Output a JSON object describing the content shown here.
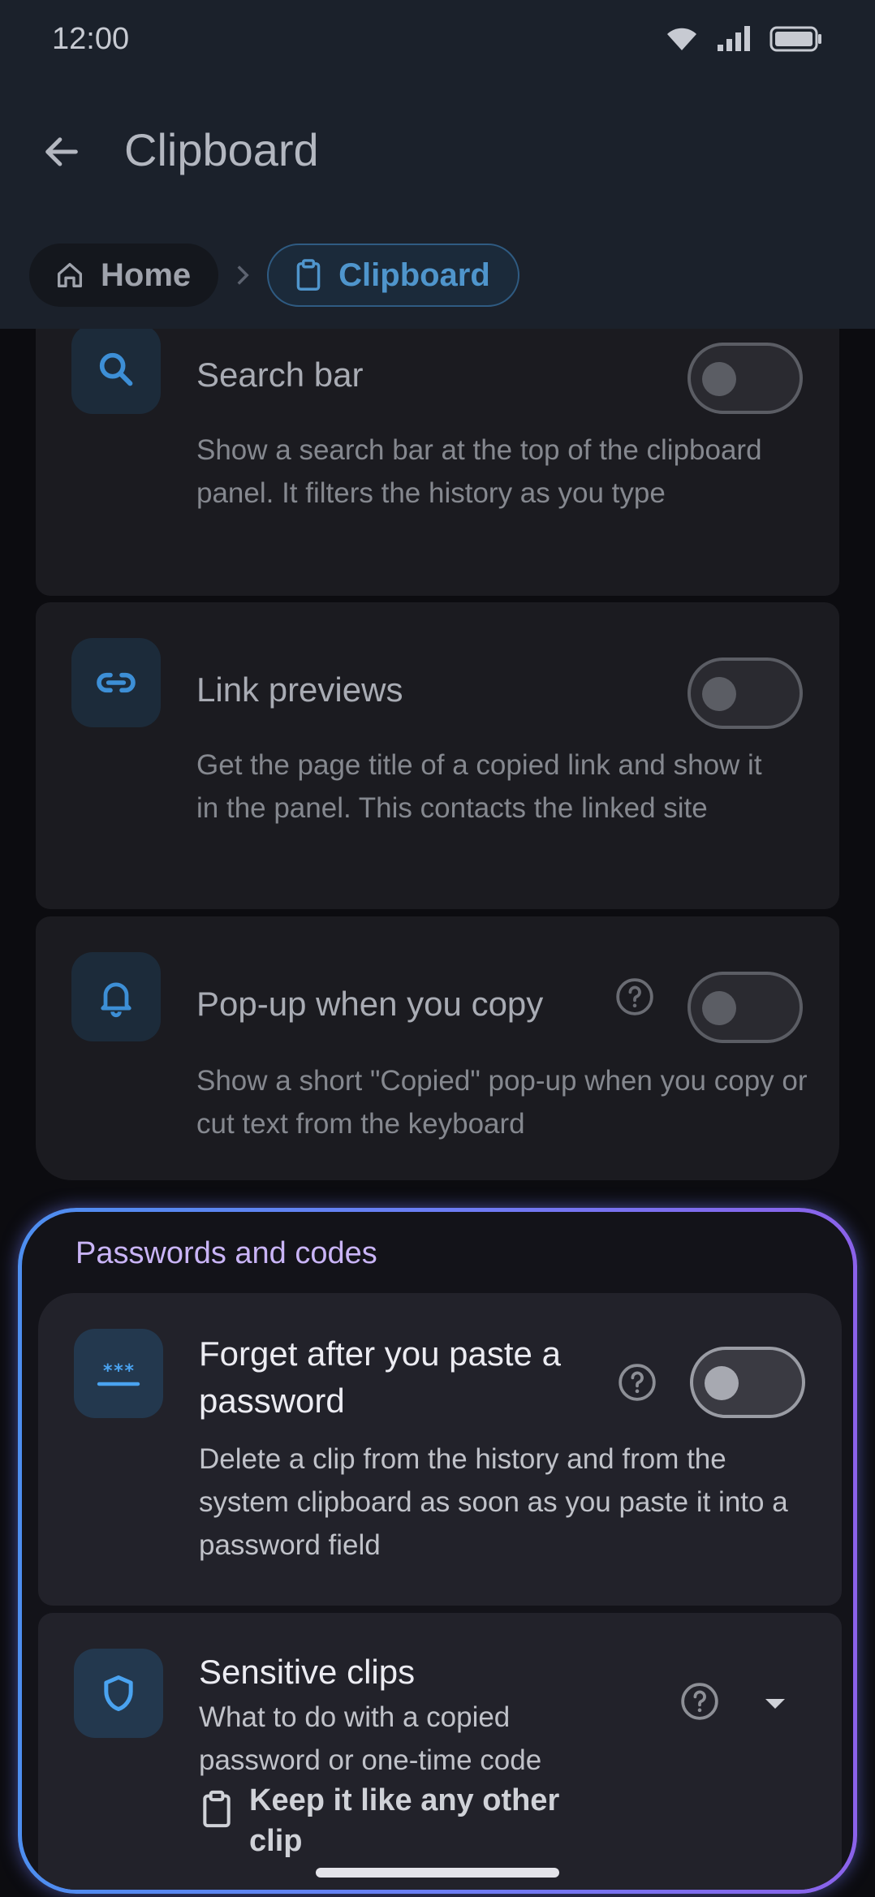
{
  "status_bar": {
    "time": "12:00"
  },
  "app_bar": {
    "title": "Clipboard"
  },
  "breadcrumb": {
    "home": "Home",
    "current": "Clipboard"
  },
  "settings": [
    {
      "title": "Search bar",
      "description": "Show a search bar at the top of the clipboard panel. It filters the history as you type",
      "icon": "search-icon",
      "enabled": false
    },
    {
      "title": "Link previews",
      "description": "Get the page title of a copied link and show it in the panel. This contacts the linked site",
      "icon": "link-icon",
      "enabled": false
    },
    {
      "title": "Pop-up when you copy",
      "description": "Show a short \"Copied\" pop-up when you copy or cut text from the keyboard",
      "icon": "bell-icon",
      "enabled": false
    }
  ],
  "section": {
    "label": "Passwords and codes",
    "forget_password": {
      "title": "Forget after you paste a password",
      "description": "Delete a clip from the history and from the system clipboard as soon as you paste it into a password field",
      "icon": "password-icon",
      "enabled": false
    },
    "sensitive_clips": {
      "title": "Sensitive clips",
      "description": "What to do with a copied password or one-time code",
      "icon": "shield-icon",
      "value": "Keep it like any other clip"
    }
  },
  "colors": {
    "accent": "#4f95cc",
    "section_gradient_start": "#4d8ef0",
    "section_gradient_end": "#8b62ea",
    "section_label": "#c9b4f6"
  }
}
